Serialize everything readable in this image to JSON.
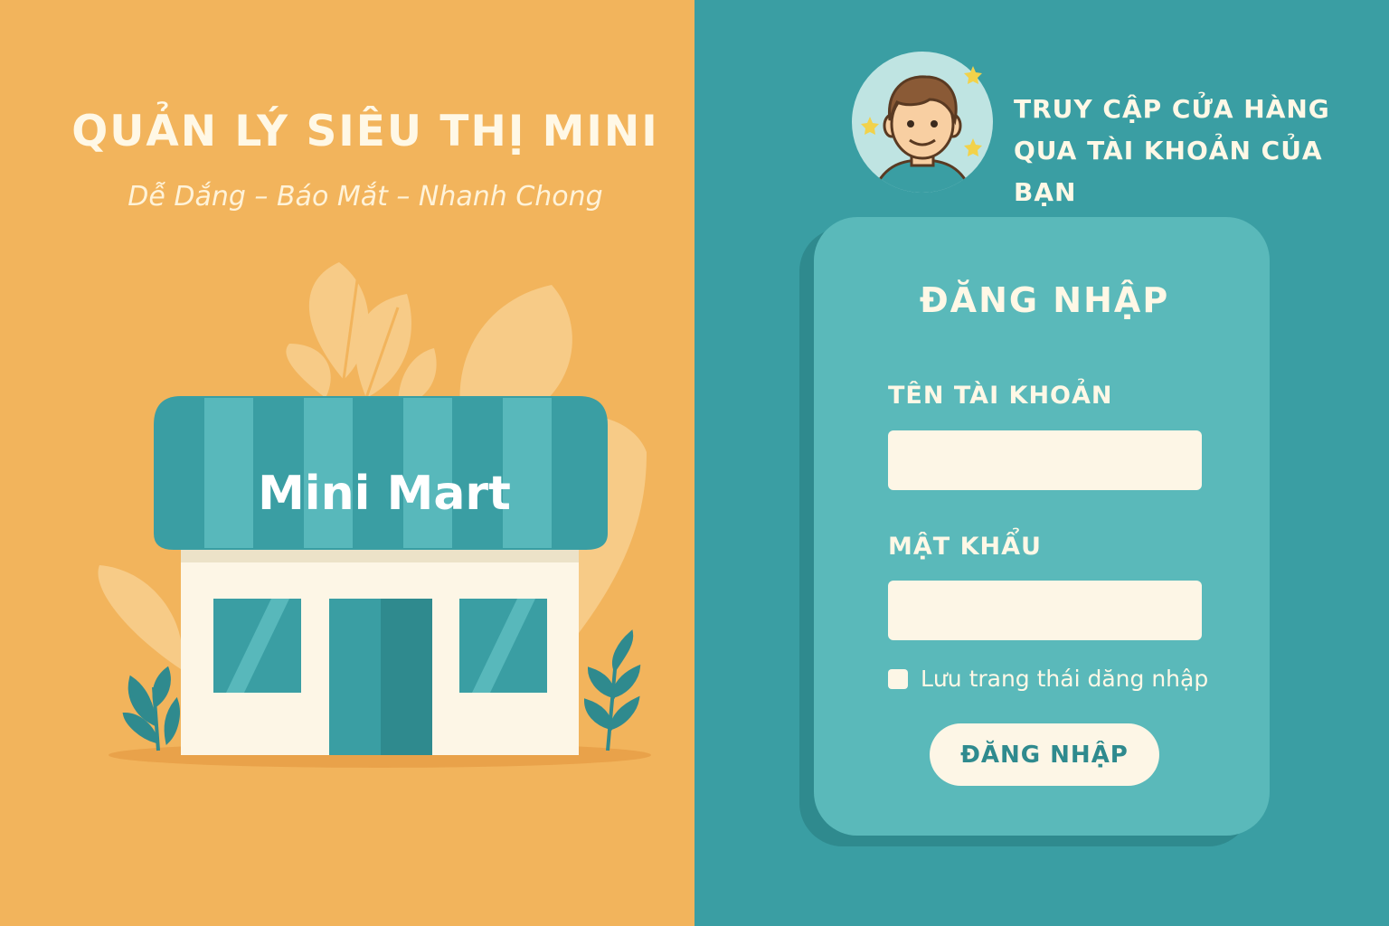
{
  "hero": {
    "title": "QUẢN LÝ SIÊU THỊ MINI",
    "tagline": "Dễ Dắng – Báo Mắt – Nhanh Chong",
    "store_sign": "Mini Mart"
  },
  "account_prompt": {
    "line1": "TRUY CẬP CỬA HÀNG",
    "line2": "QUA TÀI KHOẢN CỦA BẠN"
  },
  "login_form": {
    "title": "ĐĂNG NHẬP",
    "username_label": "TÊN TÀI KHOẢN",
    "username_value": "",
    "password_label": "MẬT KHẨU",
    "password_value": "",
    "remember_label": "Lưu trang thái dăng nhập",
    "remember_checked": false,
    "submit_label": "ĐĂNG NHẬP"
  },
  "colors": {
    "left_background": "#f2b45c",
    "right_background": "#3a9ea3",
    "card": "#5ab9ba",
    "accent_teal": "#2f8a8e",
    "cream": "#fdf6e6",
    "star": "#f2d24a"
  },
  "icons": [
    "avatar-icon",
    "star-icon",
    "store-icon",
    "leaf-icon"
  ]
}
